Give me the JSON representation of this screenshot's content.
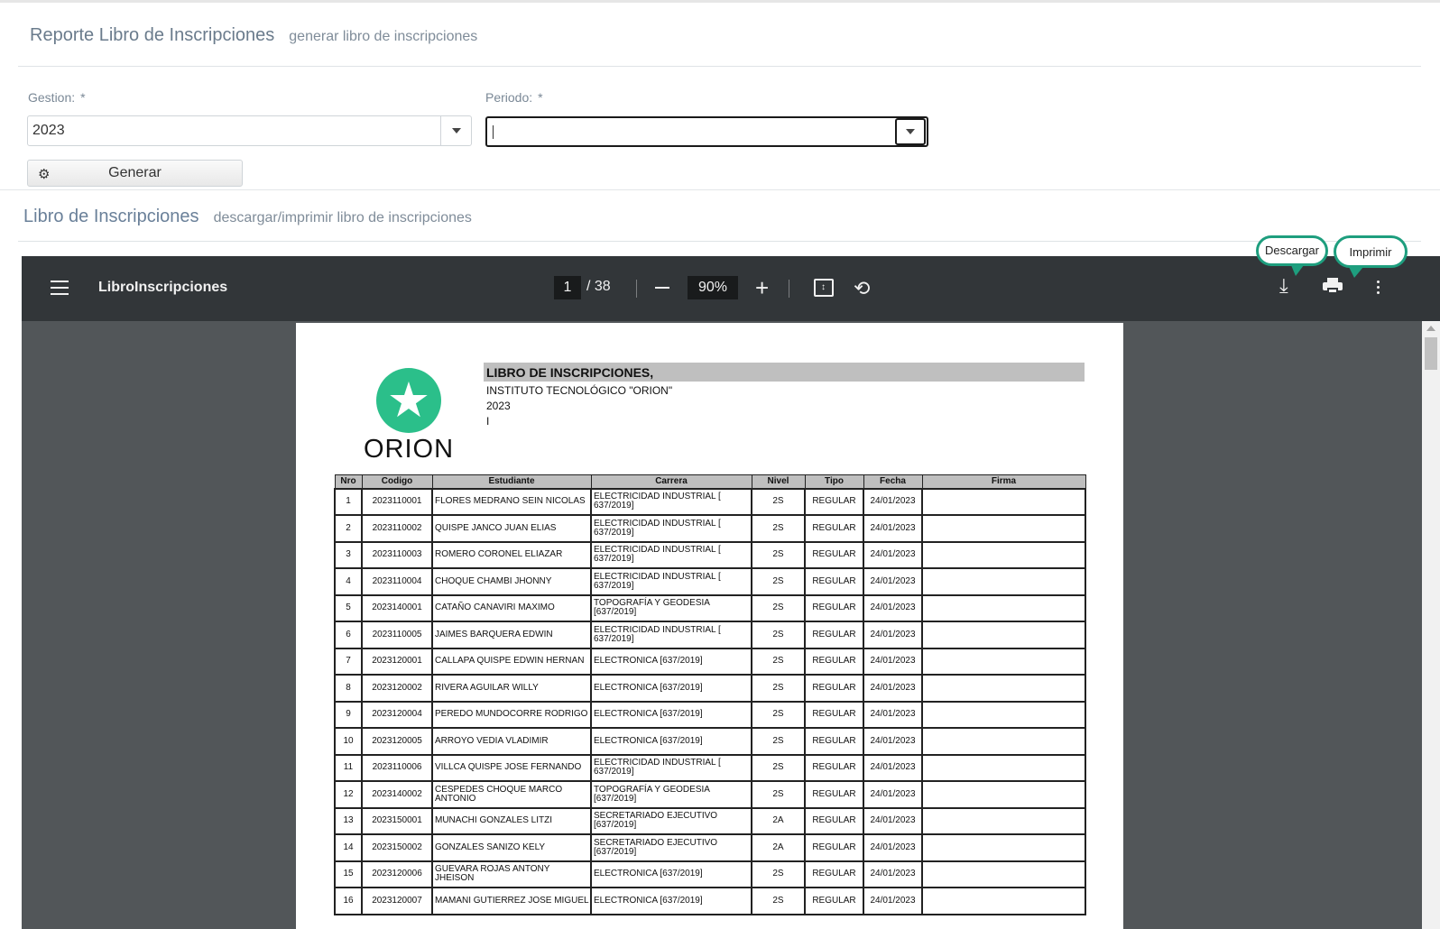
{
  "section1": {
    "title": "Reporte Libro de Inscripciones",
    "subtitle": "generar libro de inscripciones"
  },
  "form": {
    "gestion_label": "Gestion:",
    "periodo_label": "Periodo:",
    "required_mark": "*",
    "gestion_value": "2023",
    "periodo_value": "",
    "generate_label": "Generar"
  },
  "section2": {
    "title": "Libro de Inscripciones",
    "subtitle": "descargar/imprimir libro de inscripciones"
  },
  "viewer": {
    "doc_name": "LibroInscripciones",
    "page_current": "1",
    "page_total": "/ 38",
    "zoom": "90%",
    "callout_download": "Descargar",
    "callout_print": "Imprimir"
  },
  "report": {
    "logo_text": "ORION",
    "title": "LIBRO DE INSCRIPCIONES,",
    "institution": "INSTITUTO TECNOLÓGICO  \"ORION\"",
    "year": "2023",
    "period": "I",
    "headers": [
      "Nro",
      "Codigo",
      "Estudiante",
      "Carrera",
      "Nivel",
      "Tipo",
      "Fecha",
      "Firma"
    ],
    "rows": [
      [
        "1",
        "2023110001",
        "FLORES MEDRANO SEIN NICOLAS",
        "ELECTRICIDAD INDUSTRIAL [ 637/2019]",
        "2S",
        "REGULAR",
        "24/01/2023",
        ""
      ],
      [
        "2",
        "2023110002",
        "QUISPE JANCO JUAN ELIAS",
        "ELECTRICIDAD INDUSTRIAL [ 637/2019]",
        "2S",
        "REGULAR",
        "24/01/2023",
        ""
      ],
      [
        "3",
        "2023110003",
        "ROMERO CORONEL ELIAZAR",
        "ELECTRICIDAD INDUSTRIAL [ 637/2019]",
        "2S",
        "REGULAR",
        "24/01/2023",
        ""
      ],
      [
        "4",
        "2023110004",
        "CHOQUE CHAMBI JHONNY",
        "ELECTRICIDAD INDUSTRIAL [ 637/2019]",
        "2S",
        "REGULAR",
        "24/01/2023",
        ""
      ],
      [
        "5",
        "2023140001",
        "CATAÑO CANAVIRI MAXIMO",
        "TOPOGRAFÍA Y GEODESIA [637/2019]",
        "2S",
        "REGULAR",
        "24/01/2023",
        ""
      ],
      [
        "6",
        "2023110005",
        "JAIMES BARQUERA EDWIN",
        "ELECTRICIDAD INDUSTRIAL [ 637/2019]",
        "2S",
        "REGULAR",
        "24/01/2023",
        ""
      ],
      [
        "7",
        "2023120001",
        "CALLAPA QUISPE EDWIN HERNAN",
        "ELECTRONICA [637/2019]",
        "2S",
        "REGULAR",
        "24/01/2023",
        ""
      ],
      [
        "8",
        "2023120002",
        "RIVERA AGUILAR WILLY",
        "ELECTRONICA [637/2019]",
        "2S",
        "REGULAR",
        "24/01/2023",
        ""
      ],
      [
        "9",
        "2023120004",
        "PEREDO MUNDOCORRE RODRIGO",
        "ELECTRONICA [637/2019]",
        "2S",
        "REGULAR",
        "24/01/2023",
        ""
      ],
      [
        "10",
        "2023120005",
        "ARROYO VEDIA VLADIMIR",
        "ELECTRONICA [637/2019]",
        "2S",
        "REGULAR",
        "24/01/2023",
        ""
      ],
      [
        "11",
        "2023110006",
        "VILLCA QUISPE JOSE FERNANDO",
        "ELECTRICIDAD INDUSTRIAL [ 637/2019]",
        "2S",
        "REGULAR",
        "24/01/2023",
        ""
      ],
      [
        "12",
        "2023140002",
        "CESPEDES CHOQUE MARCO ANTONIO",
        "TOPOGRAFÍA Y GEODESIA [637/2019]",
        "2S",
        "REGULAR",
        "24/01/2023",
        ""
      ],
      [
        "13",
        "2023150001",
        "MUNACHI GONZALES LITZI",
        "SECRETARIADO EJECUTIVO [637/2019]",
        "2A",
        "REGULAR",
        "24/01/2023",
        ""
      ],
      [
        "14",
        "2023150002",
        "GONZALES SANIZO KELY",
        "SECRETARIADO EJECUTIVO [637/2019]",
        "2A",
        "REGULAR",
        "24/01/2023",
        ""
      ],
      [
        "15",
        "2023120006",
        "GUEVARA ROJAS ANTONY JHEISON",
        "ELECTRONICA [637/2019]",
        "2S",
        "REGULAR",
        "24/01/2023",
        ""
      ],
      [
        "16",
        "2023120007",
        "MAMANI GUTIERREZ JOSE MIGUEL",
        "ELECTRONICA [637/2019]",
        "2S",
        "REGULAR",
        "24/01/2023",
        ""
      ]
    ]
  }
}
